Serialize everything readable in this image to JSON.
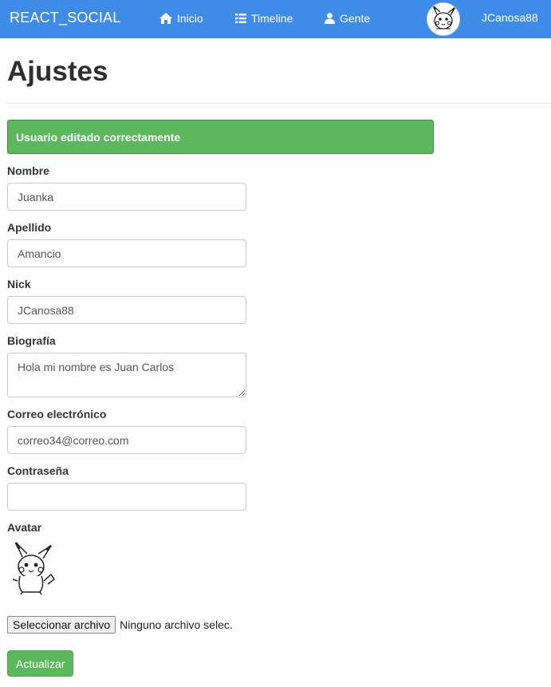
{
  "navbar": {
    "brand": "REACT_SOCIAL",
    "items": [
      {
        "label": "Inicio",
        "icon": "home-icon"
      },
      {
        "label": "Timeline",
        "icon": "list-icon"
      },
      {
        "label": "Gente",
        "icon": "user-icon"
      }
    ],
    "username": "JCanosa88",
    "background": "#3f8ce8"
  },
  "page": {
    "title": "Ajustes"
  },
  "alert": {
    "message": "Usuario editado correctamente",
    "color": "#5cb85c"
  },
  "form": {
    "nombre": {
      "label": "Nombre",
      "value": "Juanka"
    },
    "apellido": {
      "label": "Apellido",
      "value": "Amancio"
    },
    "nick": {
      "label": "Nick",
      "value": "JCanosa88"
    },
    "biografia": {
      "label": "Biografía",
      "value": "Hola mi nombre es Juan Carlos"
    },
    "correo": {
      "label": "Correo electrónico",
      "value": "correo34@correo.com"
    },
    "contrasena": {
      "label": "Contraseña",
      "value": ""
    },
    "avatar": {
      "label": "Avatar",
      "image": "pikachu-avatar"
    },
    "file": {
      "button_label": "Seleccionar archivo",
      "status": "Ninguno archivo selec."
    },
    "submit_label": "Actualizar"
  }
}
